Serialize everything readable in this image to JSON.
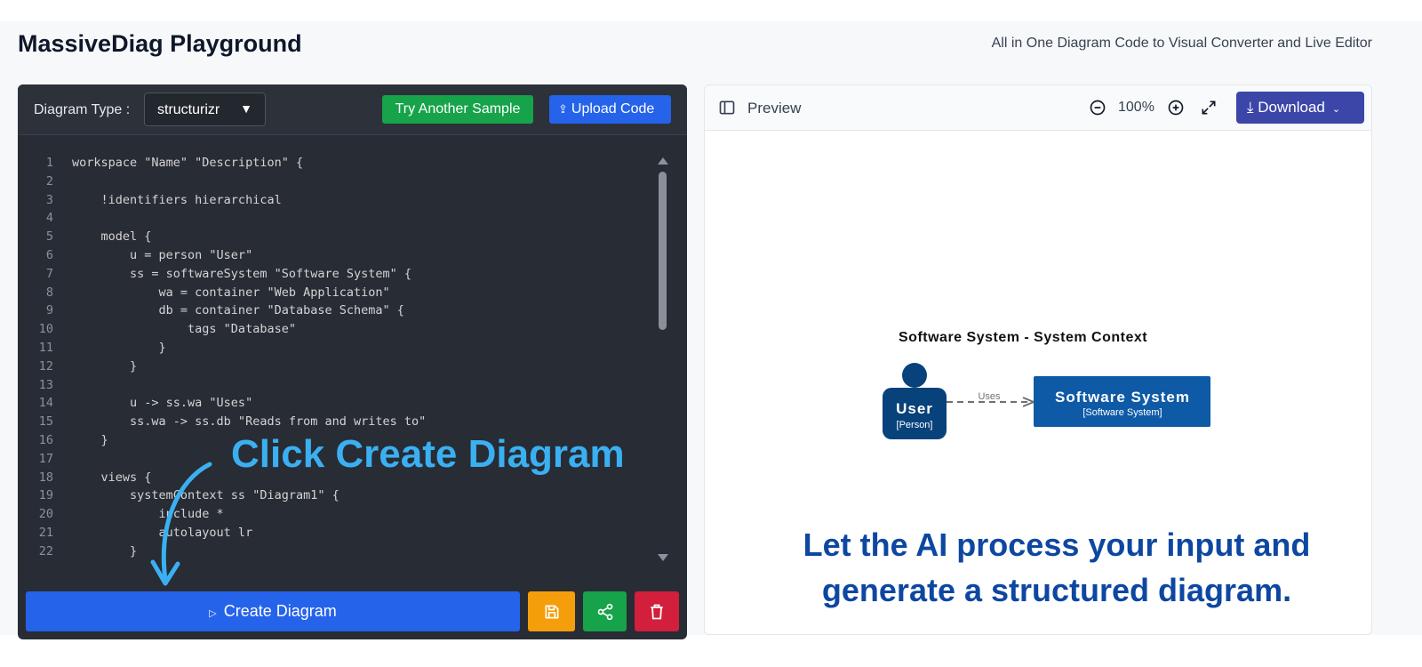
{
  "header": {
    "title": "MassiveDiag Playground",
    "subtitle": "All in One Diagram Code to Visual Converter and Live Editor"
  },
  "editor": {
    "diagram_type_label": "Diagram Type :",
    "diagram_type_value": "structurizr",
    "try_sample_label": "Try Another Sample",
    "upload_label": "Upload Code",
    "create_label": "Create Diagram",
    "code_lines": [
      {
        "n": "1",
        "t": "workspace \"Name\" \"Description\" {"
      },
      {
        "n": "2",
        "t": ""
      },
      {
        "n": "3",
        "t": "    !identifiers hierarchical"
      },
      {
        "n": "4",
        "t": ""
      },
      {
        "n": "5",
        "t": "    model {"
      },
      {
        "n": "6",
        "t": "        u = person \"User\""
      },
      {
        "n": "7",
        "t": "        ss = softwareSystem \"Software System\" {"
      },
      {
        "n": "8",
        "t": "            wa = container \"Web Application\""
      },
      {
        "n": "9",
        "t": "            db = container \"Database Schema\" {"
      },
      {
        "n": "10",
        "t": "                tags \"Database\""
      },
      {
        "n": "11",
        "t": "            }"
      },
      {
        "n": "12",
        "t": "        }"
      },
      {
        "n": "13",
        "t": ""
      },
      {
        "n": "14",
        "t": "        u -> ss.wa \"Uses\""
      },
      {
        "n": "15",
        "t": "        ss.wa -> ss.db \"Reads from and writes to\""
      },
      {
        "n": "16",
        "t": "    }"
      },
      {
        "n": "17",
        "t": ""
      },
      {
        "n": "18",
        "t": "    views {"
      },
      {
        "n": "19",
        "t": "        systemContext ss \"Diagram1\" {"
      },
      {
        "n": "20",
        "t": "            include *"
      },
      {
        "n": "21",
        "t": "            autolayout lr"
      },
      {
        "n": "22",
        "t": "        }"
      }
    ],
    "hint": "Click Create Diagram"
  },
  "preview": {
    "title": "Preview",
    "zoom": "100%",
    "download_label": "Download",
    "diagram": {
      "title": "Software System - System Context",
      "person_name": "User",
      "person_type": "[Person]",
      "relation_label": "Uses",
      "system_name": "Software System",
      "system_type": "[Software System]",
      "node_color": "#08427b",
      "system_color": "#1168bd"
    },
    "hint": "Let the AI process your input and generate a structured diagram."
  },
  "colors": {
    "accent_blue": "#2563eb",
    "green": "#16a34a",
    "amber": "#f59e0b",
    "red": "#d21f3c",
    "download": "#3b46a8"
  }
}
